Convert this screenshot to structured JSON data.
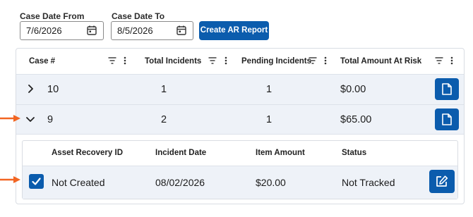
{
  "filters": {
    "from_label": "Case Date From",
    "from_value": "7/6/2026",
    "to_label": "Case Date To",
    "to_value": "8/5/2026",
    "create_button": "Create AR Report"
  },
  "table": {
    "columns": [
      "Case #",
      "Total Incidents",
      "Pending Incidents",
      "Total Amount At Risk"
    ],
    "rows": [
      {
        "case": "10",
        "total": "1",
        "pending": "1",
        "amount": "$0.00",
        "expanded": false
      },
      {
        "case": "9",
        "total": "2",
        "pending": "1",
        "amount": "$65.00",
        "expanded": true
      }
    ]
  },
  "detail": {
    "columns": [
      "Asset Recovery ID",
      "Incident Date",
      "Item Amount",
      "Status"
    ],
    "rows": [
      {
        "asset_recovery_id": "Not Created",
        "incident_date": "08/02/2026",
        "item_amount": "$20.00",
        "status": "Not Tracked",
        "checked": true
      }
    ]
  },
  "colors": {
    "accent": "#0b5cad",
    "annotation_arrow": "#f26522",
    "row_bg": "#eef2f8"
  },
  "icons": [
    "calendar-icon",
    "filter-icon",
    "kebab-menu-icon",
    "chevron-right-icon",
    "chevron-down-icon",
    "document-icon",
    "checkmark-icon",
    "edit-icon",
    "annotation-arrow"
  ]
}
